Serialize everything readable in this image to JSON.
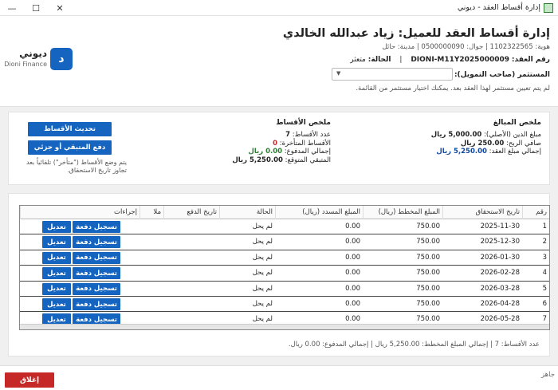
{
  "window": {
    "title": "إدارة أقساط العقد - ديوني",
    "min_glyph": "—",
    "max_glyph": "☐",
    "close_glyph": "✕"
  },
  "brand": {
    "mark": "د",
    "name_ar": "ديوني",
    "name_en": "Dioni Finance",
    "color": "#1565c0"
  },
  "header": {
    "title": "إدارة أقساط العقد للعميل: زياد عبدالله الخالدي",
    "contact_line": "هوية: 1102322565 | جوال: 0500000090 | مدينة: حائل",
    "contract_label": "رقم العقد:",
    "contract_value": "DIONI-M11Y2025000009",
    "status_label": "الحالة:",
    "status_value": "متعثر",
    "investor_label": "المستثمر (صاحب التمويل):",
    "investor_select_value": "",
    "investor_hint": "لم يتم تعيين مستثمر لهذا العقد بعد. يمكنك اختيار مستثمر من القائمة."
  },
  "summary": {
    "amounts": {
      "heading": "ملخص المبالغ",
      "principal_label": "مبلغ الدين (الأصلي):",
      "principal_value": "5,000.00 ريال",
      "profit_label": "صافي الربح:",
      "profit_value": "250.00 ريال",
      "total_label": "إجمالي مبلغ العقد:",
      "total_value": "5,250.00 ريال"
    },
    "installments": {
      "heading": "ملخص الأقساط",
      "count_label": "عدد الأقساط:",
      "count_value": "7",
      "late_label": "الأقساط المتأخرة:",
      "late_value": "0",
      "paid_label": "إجمالي المدفوع:",
      "paid_value": "0.00 ريال",
      "remaining_label": "المتبقي المتوقع:",
      "remaining_value": "5,250.00 ريال"
    },
    "refresh_button": "تحديث الأقساط",
    "pay_remaining_button": "دفع المتبقي أو جزئي",
    "note": "يتم وضع الأقساط (\"متأخر\") تلقائياً بعد تجاوز تاريخ الاستحقاق."
  },
  "table": {
    "headers": [
      "رقم",
      "تاريخ الاستحقاق",
      "المبلغ المخطط (ريال)",
      "المبلغ المسدد (ريال)",
      "الحالة",
      "تاريخ الدفع",
      "ملا",
      "إجراءات"
    ],
    "pay_label": "تسجيل دفعة",
    "edit_label": "تعديل",
    "rows": [
      {
        "num": "1",
        "due": "2025-11-30",
        "planned": "750.00",
        "paid": "0.00",
        "status": "لم يحل",
        "pay_date": "",
        "notes": ""
      },
      {
        "num": "2",
        "due": "2025-12-30",
        "planned": "750.00",
        "paid": "0.00",
        "status": "لم يحل",
        "pay_date": "",
        "notes": ""
      },
      {
        "num": "3",
        "due": "2026-01-30",
        "planned": "750.00",
        "paid": "0.00",
        "status": "لم يحل",
        "pay_date": "",
        "notes": ""
      },
      {
        "num": "4",
        "due": "2026-02-28",
        "planned": "750.00",
        "paid": "0.00",
        "status": "لم يحل",
        "pay_date": "",
        "notes": ""
      },
      {
        "num": "5",
        "due": "2026-03-28",
        "planned": "750.00",
        "paid": "0.00",
        "status": "لم يحل",
        "pay_date": "",
        "notes": ""
      },
      {
        "num": "6",
        "due": "2026-04-28",
        "planned": "750.00",
        "paid": "0.00",
        "status": "لم يحل",
        "pay_date": "",
        "notes": ""
      },
      {
        "num": "7",
        "due": "2026-05-28",
        "planned": "750.00",
        "paid": "0.00",
        "status": "لم يحل",
        "pay_date": "",
        "notes": ""
      }
    ],
    "footer": "عدد الأقساط: 7 | إجمالي المبلغ المخطط: 5,250.00 ريال | إجمالي المدفوع: 0.00 ريال."
  },
  "statusbar": {
    "text": "جاهز",
    "close_button": "إغلاق",
    "close_color": "#c62828"
  }
}
